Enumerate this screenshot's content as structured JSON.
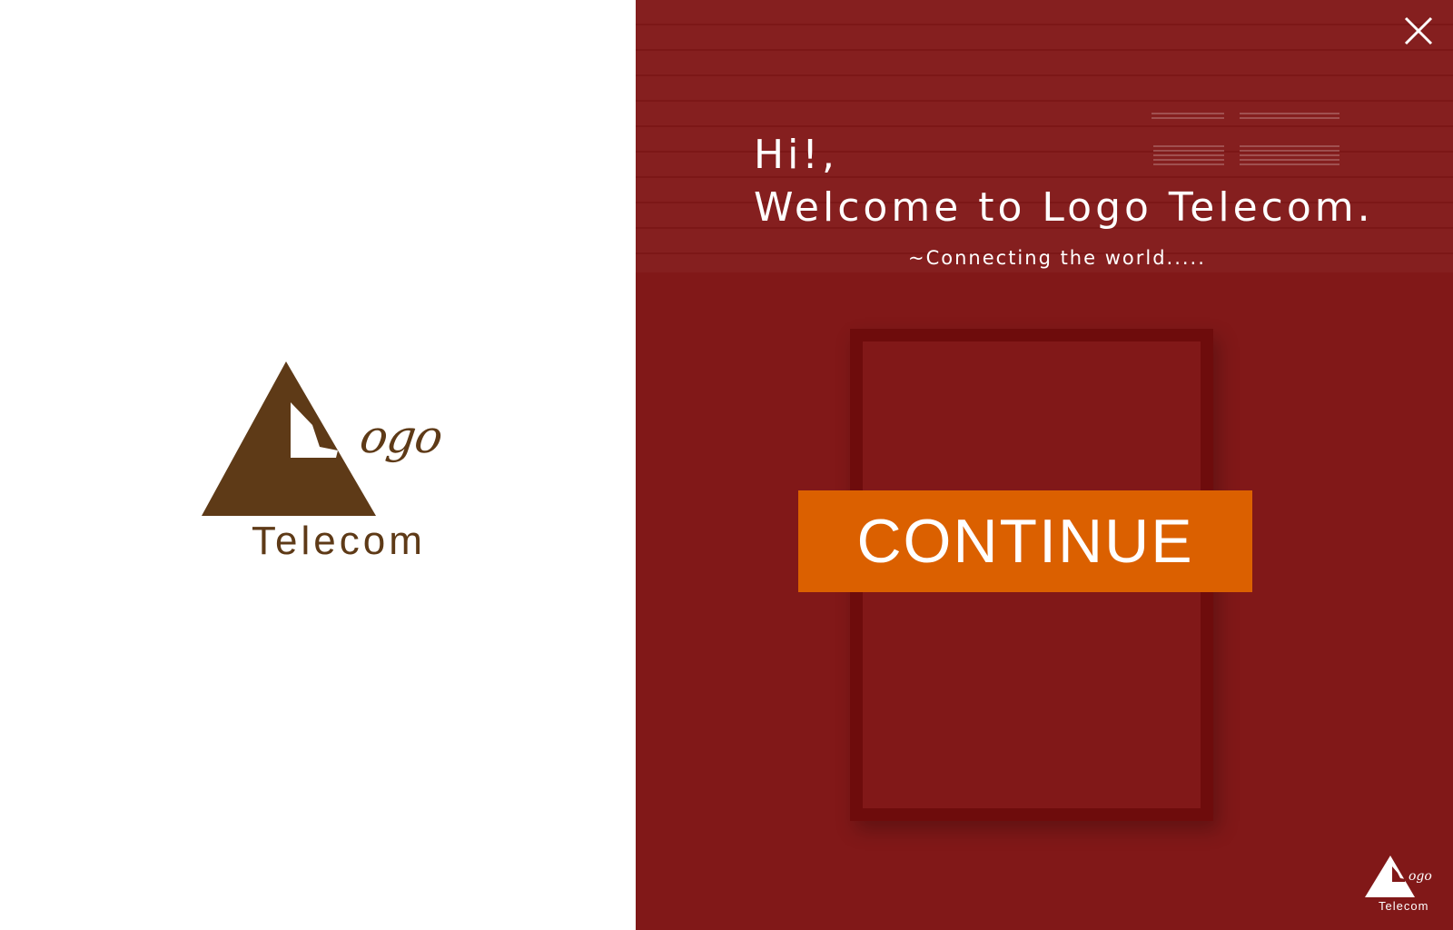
{
  "brand": {
    "script_text": "ogo",
    "word": "Telecom",
    "color": "#5e3a17"
  },
  "welcome": {
    "line1": "Hi!,",
    "line2": "Welcome to Logo Telecom.",
    "tagline": "~Connecting the world.....",
    "background_color": "#811818"
  },
  "actions": {
    "continue_label": "CONTINUE",
    "continue_color": "#db6000",
    "close_icon": "close-icon"
  },
  "mini_brand": {
    "script_text": "ogo",
    "word": "Telecom"
  }
}
